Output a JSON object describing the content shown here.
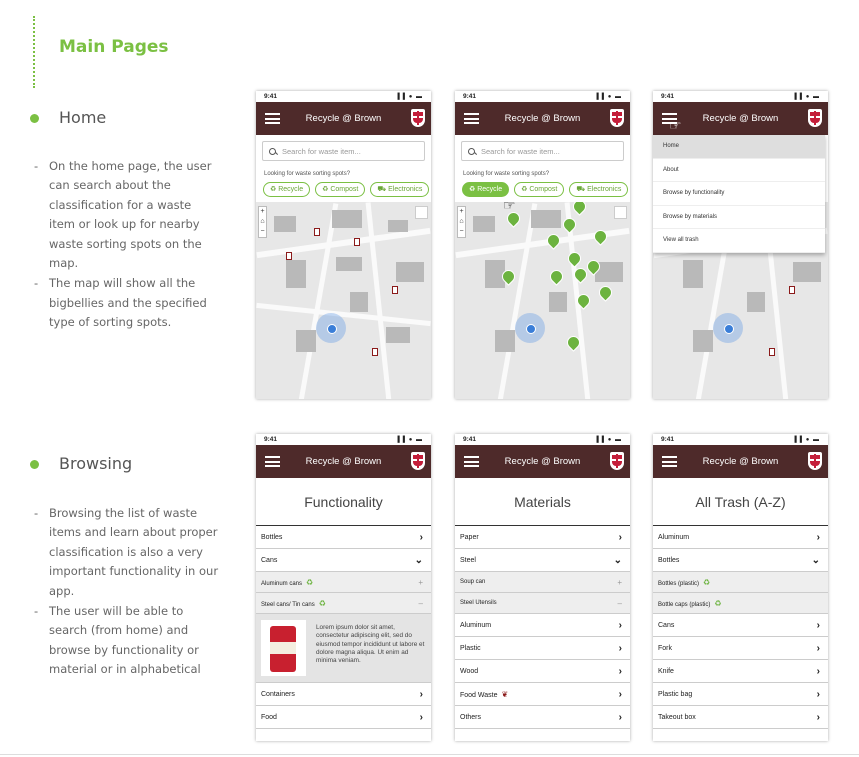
{
  "main_title": "Main Pages",
  "home": {
    "title": "Home",
    "points": [
      "On the home page, the user can search about the classification for a waste item or look up for nearby waste sorting spots on the map.",
      "The map will show all the bigbellies and the specified type of sorting spots."
    ]
  },
  "browsing": {
    "title": "Browsing",
    "points": [
      "Browsing the list of waste items and learn about proper classification is also a very important functionality in our app.",
      "The user will be able to search (from home) and browse by functionality or material or in alphabetical"
    ]
  },
  "app": {
    "time": "9:41",
    "signal": "▐▐ ● ▬",
    "title": "Recycle @ Brown"
  },
  "search": {
    "placeholder": "Search for waste item...",
    "looking": "Looking for waste sorting spots?",
    "chips": [
      "♻ Recycle",
      "♻ Compost",
      "⛟ Electronics"
    ]
  },
  "menu": [
    "Home",
    "About",
    "Browse by functionality",
    "Browse by materials",
    "View all trash"
  ],
  "functionality": {
    "header": "Functionality",
    "rows": [
      "Bottles",
      "Cans",
      "Aluminum cans",
      "Steel cans/ Tin cans",
      "Containers",
      "Food"
    ],
    "card_text": "Lorem ipsum dolor sit amet, consectetur adipiscing elit, sed do eiusmod tempor incididunt ut labore et dolore magna aliqua. Ut enim ad minima veniam."
  },
  "materials": {
    "header": "Materials",
    "rows": [
      "Paper",
      "Steel",
      "Soup can",
      "Steel Utensils",
      "Aluminum",
      "Plastic",
      "Wood",
      "Food Waste",
      "Others"
    ]
  },
  "alltrash": {
    "header": "All Trash (A-Z)",
    "rows": [
      "Aluminum",
      "Bottles",
      "Bottles (plastic)",
      "Bottle caps (plastic)",
      "Cans",
      "Fork",
      "Knife",
      "Plastic bag",
      "Takeout box"
    ]
  },
  "icons": {
    "chevron_right": "›",
    "chevron_down": "⌄",
    "plus": "+",
    "minus": "–",
    "recycle": "♻",
    "compost": "❦"
  },
  "colors": {
    "accent": "#7bc043",
    "appbar": "#4e2a2a"
  }
}
